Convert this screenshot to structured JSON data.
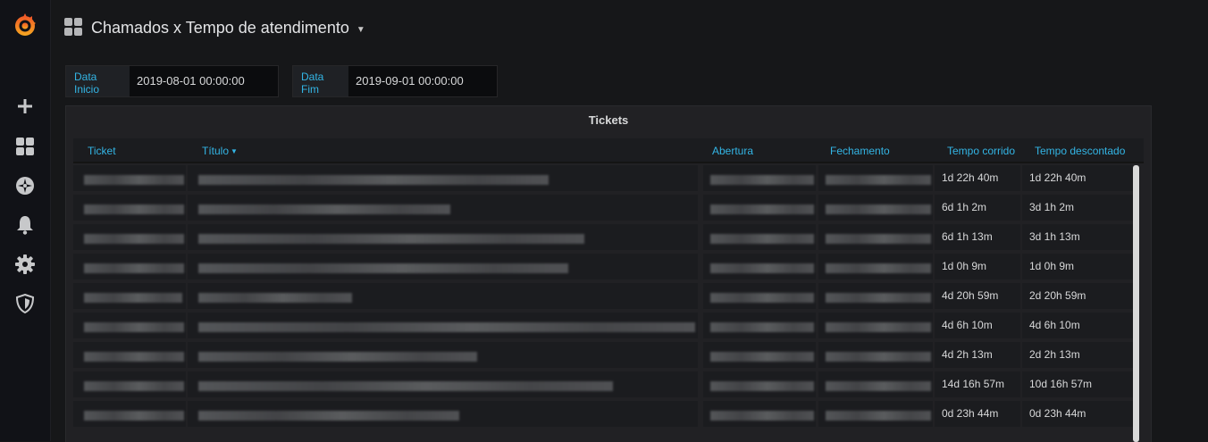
{
  "app": {
    "dashboard_title": "Chamados x Tempo de atendimento",
    "accent_color": "#33b5e5"
  },
  "sidemenu": {
    "items": [
      {
        "icon": "grafana-logo-icon"
      },
      {
        "icon": "plus-icon"
      },
      {
        "icon": "dashboards-grid-icon"
      },
      {
        "icon": "explore-compass-icon"
      },
      {
        "icon": "alerting-bell-icon"
      },
      {
        "icon": "configuration-gear-icon"
      },
      {
        "icon": "server-admin-shield-icon"
      }
    ]
  },
  "variables": {
    "data_inicio": {
      "label": "Data Inicio",
      "value": "2019-08-01 00:00:00"
    },
    "data_fim": {
      "label": "Data Fim",
      "value": "2019-09-01 00:00:00"
    }
  },
  "panel": {
    "title": "Tickets",
    "columns": [
      "Ticket",
      "Título",
      "Abertura",
      "Fechamento",
      "Tempo corrido",
      "Tempo descontado"
    ],
    "sort_column": "Título",
    "rows": [
      {
        "tempo_corrido": "1d 22h 40m",
        "tempo_descontado": "1d 22h 40m"
      },
      {
        "tempo_corrido": "6d 1h 2m",
        "tempo_descontado": "3d 1h 2m"
      },
      {
        "tempo_corrido": "6d 1h 13m",
        "tempo_descontado": "3d 1h 13m"
      },
      {
        "tempo_corrido": "1d 0h 9m",
        "tempo_descontado": "1d 0h 9m"
      },
      {
        "tempo_corrido": "4d 20h 59m",
        "tempo_descontado": "2d 20h 59m"
      },
      {
        "tempo_corrido": "4d 6h 10m",
        "tempo_descontado": "4d 6h 10m"
      },
      {
        "tempo_corrido": "4d 2h 13m",
        "tempo_descontado": "2d 2h 13m"
      },
      {
        "tempo_corrido": "14d 16h 57m",
        "tempo_descontado": "10d 16h 57m"
      },
      {
        "tempo_corrido": "0d 23h 44m",
        "tempo_descontado": "0d 23h 44m"
      }
    ]
  }
}
